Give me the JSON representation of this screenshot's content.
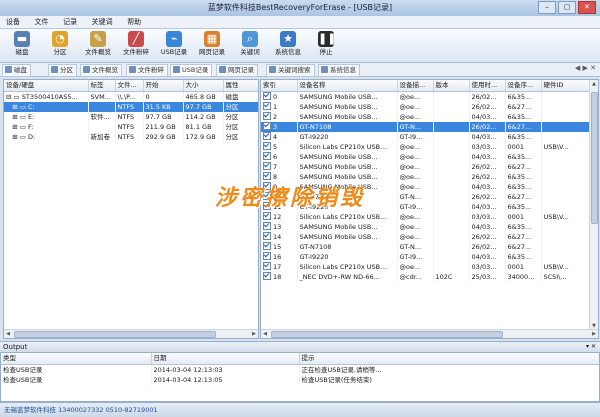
{
  "window": {
    "title": "蓝梦软件科技BestRecoveryForErase - [USB记录]",
    "controls": [
      "–",
      "▢",
      "✕"
    ]
  },
  "menu": [
    "设备",
    "文件",
    "记录",
    "关键词",
    "帮助"
  ],
  "toolbar": [
    {
      "label": "磁盘",
      "icon": "disk-icon",
      "color": "#5a7fb6"
    },
    {
      "label": "分区",
      "icon": "partition-icon",
      "color": "#e3a22b"
    },
    {
      "label": "文件概览",
      "icon": "file-overview-icon",
      "color": "#c8a04a"
    },
    {
      "label": "文件粉碎",
      "icon": "shred-icon",
      "color": "#c94a4a"
    },
    {
      "label": "USB记录",
      "icon": "usb-icon",
      "color": "#3a86d6"
    },
    {
      "label": "网页记录",
      "icon": "web-icon",
      "color": "#d9822b"
    },
    {
      "label": "关键词",
      "icon": "keyword-icon",
      "color": "#4f97d8"
    },
    {
      "label": "系统信息",
      "icon": "system-info-icon",
      "color": "#3e7bc7"
    },
    {
      "label": "停止",
      "icon": "stop-icon",
      "color": "#2b2b2b"
    }
  ],
  "tabs": [
    "磁盘",
    "分区",
    "文件概览",
    "文件粉碎",
    "USB记录",
    "网页记录",
    "关键词搜索",
    "系统信息"
  ],
  "disk_table": {
    "columns": [
      "设备/硬盘",
      "标签",
      "文件...",
      "开始",
      "大小",
      "属性"
    ],
    "rows": [
      {
        "name": "ST3500410AS5...",
        "label": "SVM...",
        "fs": "\\\\.\\P...",
        "start": "0",
        "size": "465.8 GB",
        "attr": "磁盘",
        "level": 0,
        "sel": false
      },
      {
        "name": "C:",
        "label": "",
        "fs": "NTFS",
        "start": "31.5 KB",
        "size": "97.7 GB",
        "attr": "分区",
        "level": 1,
        "sel": true
      },
      {
        "name": "E:",
        "label": "软件...",
        "fs": "NTFS",
        "start": "97.7 GB",
        "size": "114.2 GB",
        "attr": "分区",
        "level": 1,
        "sel": false
      },
      {
        "name": "F:",
        "label": "",
        "fs": "NTFS",
        "start": "211.9 GB",
        "size": "81.1 GB",
        "attr": "分区",
        "level": 1,
        "sel": false
      },
      {
        "name": "D:",
        "label": "新加卷",
        "fs": "NTFS",
        "start": "292.9 GB",
        "size": "172.9 GB",
        "attr": "分区",
        "level": 1,
        "sel": false
      }
    ]
  },
  "usb_table": {
    "columns": [
      "索引",
      "设备名称",
      "设备描...",
      "版本",
      "使用时...",
      "设备序...",
      "硬件ID"
    ],
    "rows": [
      {
        "idx": "0",
        "name": "SAMSUNG Mobile USB...",
        "desc": "@oe...",
        "ver": "",
        "time": "26/02...",
        "serial": "6&35...",
        "hw": "",
        "sel": false
      },
      {
        "idx": "1",
        "name": "SAMSUNG Mobile USB...",
        "desc": "@oe...",
        "ver": "",
        "time": "26/02...",
        "serial": "6&27...",
        "hw": "",
        "sel": false
      },
      {
        "idx": "2",
        "name": "SAMSUNG Mobile USB...",
        "desc": "@oe...",
        "ver": "",
        "time": "04/03...",
        "serial": "6&35...",
        "hw": "",
        "sel": false
      },
      {
        "idx": "3",
        "name": "GT-N7108",
        "desc": "GT-N...",
        "ver": "",
        "time": "26/02...",
        "serial": "6&27...",
        "hw": "",
        "sel": true
      },
      {
        "idx": "4",
        "name": "GT-I9220",
        "desc": "GT-I9...",
        "ver": "",
        "time": "04/03...",
        "serial": "6&35...",
        "hw": "",
        "sel": false
      },
      {
        "idx": "5",
        "name": "Silicon Labs CP210x USB...",
        "desc": "@oe...",
        "ver": "",
        "time": "03/03...",
        "serial": "0001",
        "hw": "USB\\V...",
        "sel": false
      },
      {
        "idx": "6",
        "name": "SAMSUNG Mobile USB...",
        "desc": "@oe...",
        "ver": "",
        "time": "04/03...",
        "serial": "6&35...",
        "hw": "",
        "sel": false
      },
      {
        "idx": "7",
        "name": "SAMSUNG Mobile USB...",
        "desc": "@oe...",
        "ver": "",
        "time": "26/02...",
        "serial": "6&27...",
        "hw": "",
        "sel": false
      },
      {
        "idx": "8",
        "name": "SAMSUNG Mobile USB...",
        "desc": "@oe...",
        "ver": "",
        "time": "26/02...",
        "serial": "6&35...",
        "hw": "",
        "sel": false
      },
      {
        "idx": "9",
        "name": "SAMSUNG Mobile USB...",
        "desc": "@oe...",
        "ver": "",
        "time": "04/03...",
        "serial": "6&35...",
        "hw": "",
        "sel": false
      },
      {
        "idx": "10",
        "name": "GT-N7108",
        "desc": "GT-N...",
        "ver": "",
        "time": "26/02...",
        "serial": "6&27...",
        "hw": "",
        "sel": false
      },
      {
        "idx": "11",
        "name": "GT-I9220",
        "desc": "GT-I9...",
        "ver": "",
        "time": "04/03...",
        "serial": "6&35...",
        "hw": "",
        "sel": false
      },
      {
        "idx": "12",
        "name": "Silicon Labs CP210x USB...",
        "desc": "@oe...",
        "ver": "",
        "time": "03/03...",
        "serial": "0001",
        "hw": "USB\\V...",
        "sel": false
      },
      {
        "idx": "13",
        "name": "SAMSUNG Mobile USB...",
        "desc": "@oe...",
        "ver": "",
        "time": "04/03...",
        "serial": "6&35...",
        "hw": "",
        "sel": false
      },
      {
        "idx": "14",
        "name": "SAMSUNG Mobile USB...",
        "desc": "@oe...",
        "ver": "",
        "time": "26/02...",
        "serial": "6&27...",
        "hw": "",
        "sel": false
      },
      {
        "idx": "15",
        "name": "GT-N7108",
        "desc": "GT-N...",
        "ver": "",
        "time": "26/02...",
        "serial": "6&27...",
        "hw": "",
        "sel": false
      },
      {
        "idx": "16",
        "name": "GT-I9220",
        "desc": "GT-I9...",
        "ver": "",
        "time": "04/03...",
        "serial": "6&35...",
        "hw": "",
        "sel": false
      },
      {
        "idx": "17",
        "name": "Silicon Labs CP210x USB...",
        "desc": "@oe...",
        "ver": "",
        "time": "03/03...",
        "serial": "0001",
        "hw": "USB\\V...",
        "sel": false
      },
      {
        "idx": "18",
        "name": "_NEC DVD+-RW ND-66...",
        "desc": "@cdr...",
        "ver": "102C",
        "time": "25/03...",
        "serial": "34000...",
        "hw": "SCSI\\...",
        "sel": false
      }
    ]
  },
  "watermark": "涉密擦除销毁",
  "output": {
    "title": "Output",
    "pin": "▾ ✕",
    "columns": [
      "类型",
      "日期",
      "提示"
    ],
    "rows": [
      {
        "type": "检查USB记录",
        "date": "2014-03-04 12:13:03",
        "msg": "正在检查USB记录,请稍等..."
      },
      {
        "type": "检查USB记录",
        "date": "2014-03-04 12:13:05",
        "msg": "检查USB记录(任务结束)"
      }
    ]
  },
  "status": "无锡蓝梦软件科技 13400027332  0510-82719001"
}
